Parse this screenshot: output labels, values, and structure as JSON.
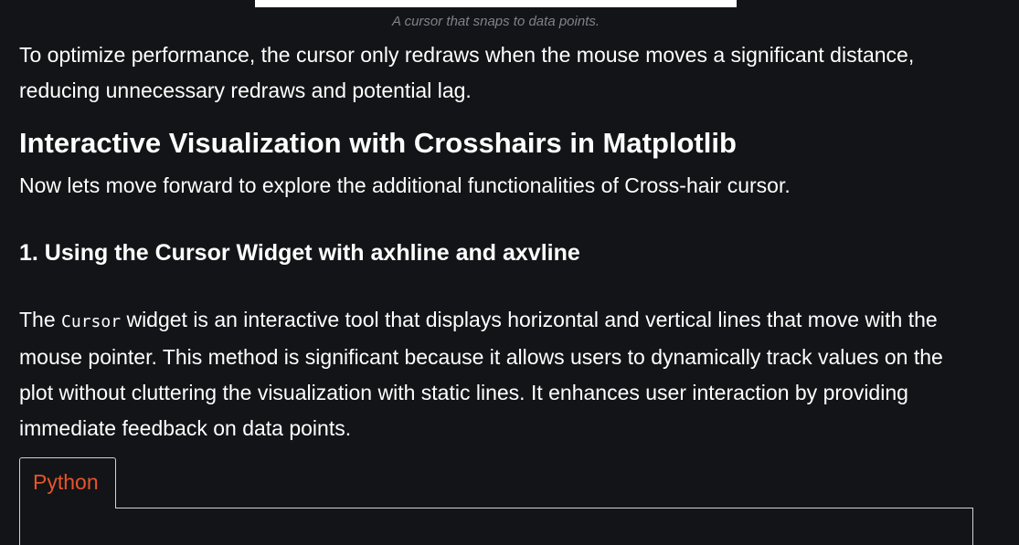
{
  "figure": {
    "caption": "A cursor that snaps to data points."
  },
  "article": {
    "paragraph_1": "To optimize performance, the cursor only redraws when the mouse moves a significant distance, reducing unnecessary redraws and potential lag.",
    "heading_2": "Interactive Visualization with Crosshairs in Matplotlib",
    "paragraph_2": "Now lets move forward to explore the additional functionalities of Cross-hair cursor.",
    "heading_3": "1. Using the Cursor Widget with axhline and axvline",
    "paragraph_3": {
      "lead": "The ",
      "code": "Cursor",
      "tail": " widget is an interactive tool that displays horizontal and vertical lines that move with the mouse pointer. This method is significant because it allows users to dynamically track values on the plot without cluttering the visualization with static lines. It enhances user interaction by providing immediate feedback on data points."
    }
  },
  "code_block": {
    "tabs": [
      {
        "label": "Python",
        "active": true
      }
    ],
    "accent_color": "#e8542a"
  },
  "colors": {
    "background": "#131417",
    "text": "#ffffff",
    "caption": "#7f8289"
  }
}
